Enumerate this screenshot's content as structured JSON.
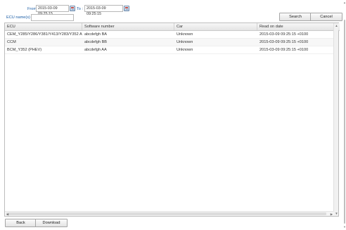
{
  "filter": {
    "from_label": "From :",
    "from_value": "2015-03-09 09:25:15",
    "to_label": "To :",
    "to_value": "2015-03-09 09:25:15",
    "ecu_label": "ECU name(s) :",
    "ecu_value": ""
  },
  "actions": {
    "search_label": "Search",
    "cancel_label": "Cancel",
    "back_label": "Back",
    "download_label": "Download"
  },
  "table": {
    "headers": [
      "ECU",
      "Software number",
      "Car",
      "Read on date"
    ],
    "rows": [
      [
        "CEM_Y285/Y286/Y381/Y413/Y283/Y352 Alle ut...",
        "abcdefgh BA",
        "Unknown",
        "2015-03-09 09:25:15 +0100"
      ],
      [
        "CCM",
        "abcdefgh BB",
        "Unknown",
        "2015-03-09 09:25:15 +0100"
      ],
      [
        "BCM_Y352 (PHEV)",
        "abcdefgh AA",
        "Unknown",
        "2015-03-09 09:25:15 +0100"
      ]
    ]
  },
  "icons": {
    "calendar": "calendar-icon",
    "scroll_up": "arrow-up-icon",
    "scroll_down": "arrow-down-icon",
    "scroll_left": "arrow-left-icon",
    "scroll_right": "arrow-right-icon"
  },
  "colors": {
    "label_blue": "#1a5da6",
    "header_bg": "#e4e4e4",
    "row_alt": "#f7f7f7"
  }
}
